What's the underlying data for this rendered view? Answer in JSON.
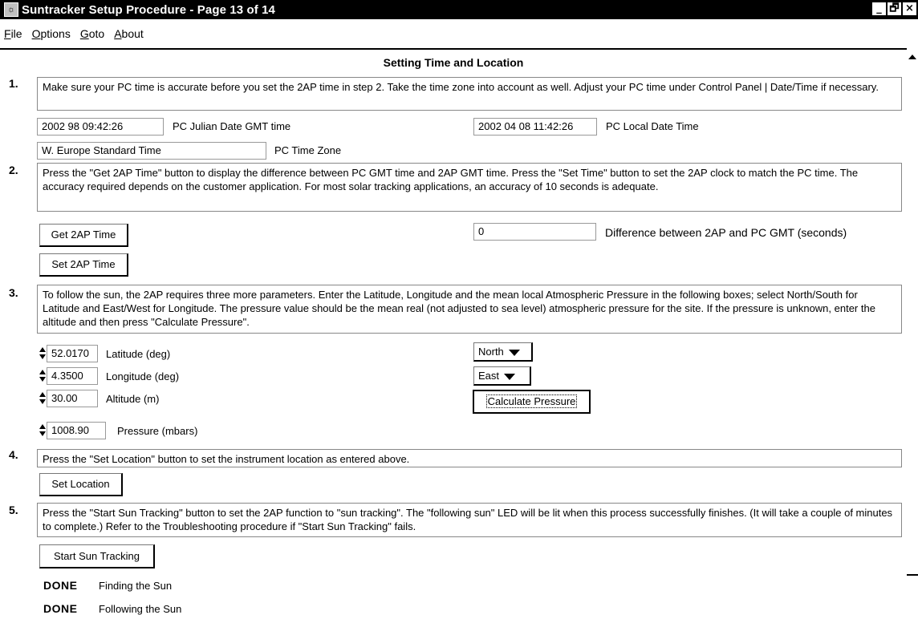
{
  "window": {
    "title": "Suntracker Setup Procedure - Page 13 of 14",
    "app_icon": "sun-icon",
    "buttons": {
      "minimize": "_",
      "maximize": "🗗",
      "close": "×"
    }
  },
  "menu": [
    "File",
    "Options",
    "Goto",
    "About"
  ],
  "heading": "Setting Time and Location",
  "steps": [
    {
      "num": "1.",
      "text": "Make sure your PC time is accurate before you set the 2AP time in step 2. Take the time zone into account as well.  Adjust your PC time under Control Panel | Date/Time if necessary."
    },
    {
      "num": "2.",
      "text": "Press the \"Get 2AP Time\" button to display the difference between PC GMT time and 2AP GMT time. Press the \"Set Time\" button to set the 2AP clock to match the PC time. The accuracy required depends on the customer application.  For most solar tracking applications, an accuracy of 10 seconds is adequate."
    },
    {
      "num": "3.",
      "text": "To follow the sun, the 2AP requires three more parameters.  Enter the Latitude, Longitude and the mean local Atmospheric Pressure in the following boxes; select North/South for Latitude and East/West for Longitude. The pressure value should be the mean real (not adjusted to sea level) atmospheric pressure for the site.  If the pressure is unknown, enter the altitude and then press \"Calculate Pressure\"."
    },
    {
      "num": "4.",
      "text": "Press the \"Set Location\" button to set the instrument location as entered above."
    },
    {
      "num": "5.",
      "text": "Press the \"Start Sun Tracking\" button to set the 2AP function to \"sun tracking\".  The \"following sun\" LED will be lit when this process successfully finishes. (It will take a couple of minutes to complete.)  Refer to the Troubleshooting procedure if \"Start Sun Tracking\" fails."
    }
  ],
  "time": {
    "julian_gmt": "2002 98 09:42:26",
    "julian_gmt_label": "PC Julian Date GMT time",
    "local": "2002 04 08 11:42:26",
    "local_label": "PC Local Date Time",
    "zone": "W. Europe Standard Time",
    "zone_label": "PC Time Zone"
  },
  "clock": {
    "get_button": "Get 2AP Time",
    "set_button": "Set 2AP Time",
    "difference": "0",
    "difference_label": "Difference between 2AP and PC GMT (seconds)"
  },
  "location": {
    "latitude": "52.0170",
    "latitude_label": "Latitude (deg)",
    "longitude": "4.3500",
    "longitude_label": "Longitude (deg)",
    "altitude": "30.00",
    "altitude_label": "Altitude (m)",
    "pressure": "1008.90",
    "pressure_label": "Pressure (mbars)",
    "ns": "North",
    "ew": "East",
    "calc_button": "Calculate Pressure",
    "set_button": "Set Location"
  },
  "tracking": {
    "start_button": "Start Sun Tracking",
    "status": [
      {
        "state": "DONE",
        "label": "Finding the Sun"
      },
      {
        "state": "DONE",
        "label": "Following the Sun"
      }
    ]
  }
}
